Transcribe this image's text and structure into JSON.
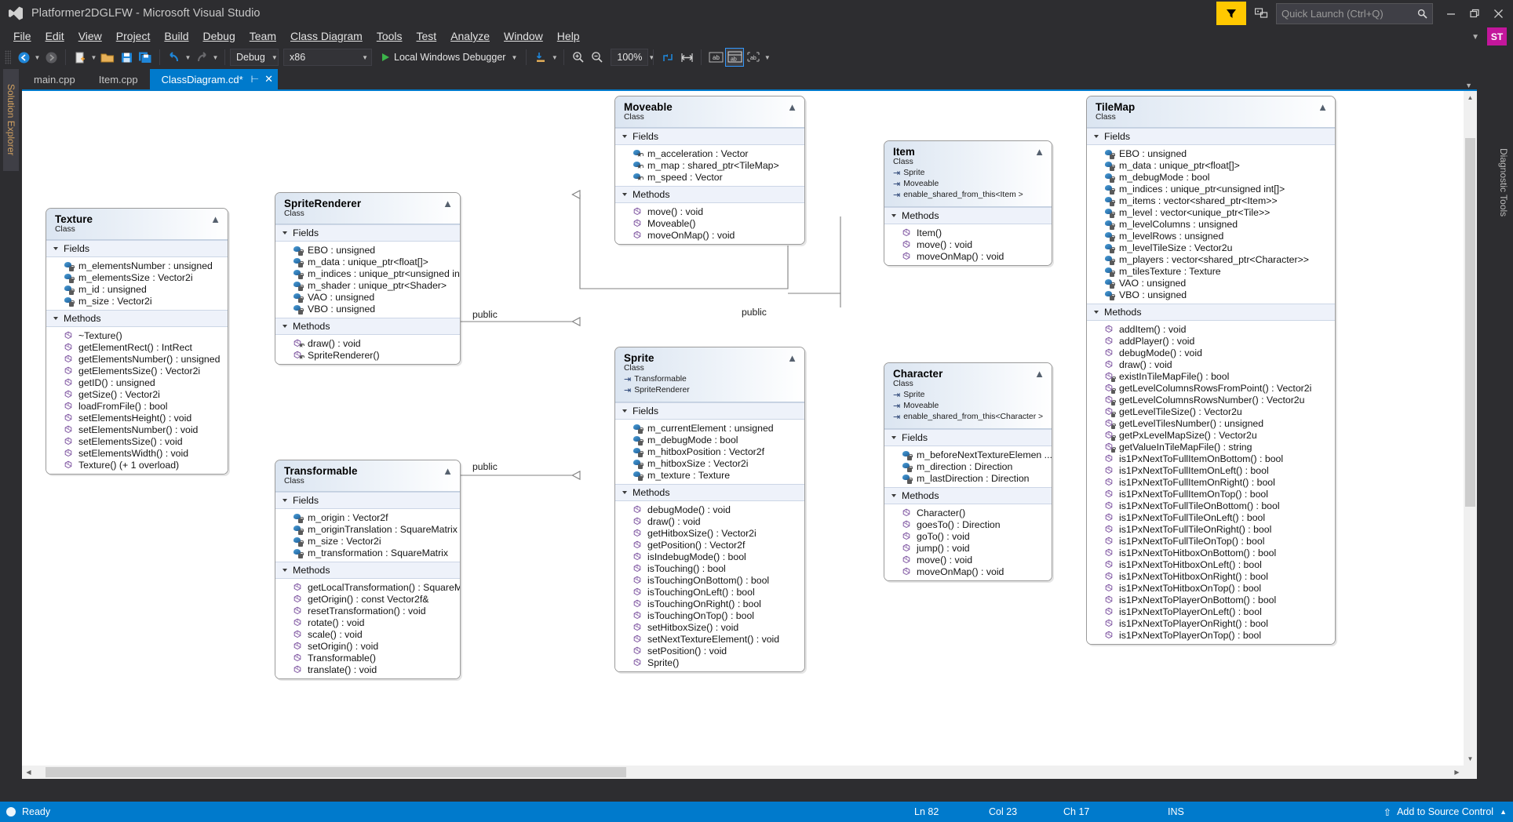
{
  "window": {
    "title": "Platformer2DGLFW - Microsoft Visual Studio",
    "logo_icon": "visual-studio-logo",
    "minimize_icon": "minimize-icon",
    "restore_icon": "restore-icon",
    "close_icon": "close-icon"
  },
  "quick_launch": {
    "placeholder": "Quick Launch (Ctrl+Q)",
    "value": "",
    "search_icon": "magnifier-icon"
  },
  "account": {
    "initials": "ST",
    "color": "#c3169c"
  },
  "feedback_icon": "send-feedback-icon",
  "notify_flag_icon": "notification-flag-icon",
  "menu": [
    {
      "label": "File"
    },
    {
      "label": "Edit"
    },
    {
      "label": "View"
    },
    {
      "label": "Project"
    },
    {
      "label": "Build"
    },
    {
      "label": "Debug"
    },
    {
      "label": "Team"
    },
    {
      "label": "Class Diagram"
    },
    {
      "label": "Tools"
    },
    {
      "label": "Test"
    },
    {
      "label": "Analyze"
    },
    {
      "label": "Window"
    },
    {
      "label": "Help"
    }
  ],
  "toolbar": {
    "nav_back_icon": "navigate-back-icon",
    "nav_forward_icon": "navigate-forward-icon",
    "new_item_icon": "new-item-icon",
    "open_file_icon": "open-file-icon",
    "save_icon": "save-icon",
    "save_all_icon": "save-all-icon",
    "undo_icon": "undo-icon",
    "redo_icon": "redo-icon",
    "config": "Debug",
    "platform": "x86",
    "start_label": "Local Windows Debugger",
    "start_icon": "play-icon",
    "step_icon": "step-into-icon",
    "zoom_in_icon": "zoom-in-icon",
    "zoom_out_icon": "zoom-out-icon",
    "zoom_value": "100%",
    "layout_icon": "auto-layout-icon",
    "fit_icon": "fit-width-icon",
    "member_format_full_icon": "display-full-signature-icon",
    "member_format_name_icon": "display-name-icon",
    "member_format_none_icon": "display-name-and-type-icon"
  },
  "tabs": [
    {
      "label": "main.cpp",
      "active": false
    },
    {
      "label": "Item.cpp",
      "active": false
    },
    {
      "label": "ClassDiagram.cd*",
      "active": true,
      "pin_icon": "pin-icon",
      "close_icon": "close-icon"
    }
  ],
  "left_rail": {
    "label": "Solution Explorer"
  },
  "right_rail": {
    "label": "Diagnostic Tools"
  },
  "canvas": {
    "section_fields": "Fields",
    "section_methods": "Methods",
    "kind_label": "Class",
    "collapse_icon": "collapse-chevron-icon",
    "connector_label": "public"
  },
  "classes": [
    {
      "id": "texture",
      "name": "Texture",
      "kind": "Class",
      "bases": [],
      "fields": [
        {
          "name": "m_elementsNumber : unsigned",
          "access": "private"
        },
        {
          "name": "m_elementsSize : Vector2i",
          "access": "private"
        },
        {
          "name": "m_id : unsigned",
          "access": "private"
        },
        {
          "name": "m_size : Vector2i",
          "access": "private"
        }
      ],
      "methods": [
        {
          "name": "~Texture()",
          "access": "public"
        },
        {
          "name": "getElementRect() : IntRect",
          "access": "public"
        },
        {
          "name": "getElementsNumber() : unsigned",
          "access": "public"
        },
        {
          "name": "getElementsSize() : Vector2i",
          "access": "public"
        },
        {
          "name": "getID() : unsigned",
          "access": "public"
        },
        {
          "name": "getSize() : Vector2i",
          "access": "public"
        },
        {
          "name": "loadFromFile() : bool",
          "access": "public"
        },
        {
          "name": "setElementsHeight() : void",
          "access": "public"
        },
        {
          "name": "setElementsNumber() : void",
          "access": "public"
        },
        {
          "name": "setElementsSize() : void",
          "access": "public"
        },
        {
          "name": "setElementsWidth() : void",
          "access": "public"
        },
        {
          "name": "Texture() (+ 1 overload)",
          "access": "public"
        }
      ]
    },
    {
      "id": "spriterenderer",
      "name": "SpriteRenderer",
      "kind": "Class",
      "bases": [],
      "fields": [
        {
          "name": "EBO : unsigned",
          "access": "private"
        },
        {
          "name": "m_data : unique_ptr<float[]>",
          "access": "private"
        },
        {
          "name": "m_indices : unique_ptr<unsigned int[]>",
          "access": "private"
        },
        {
          "name": "m_shader : unique_ptr<Shader>",
          "access": "private"
        },
        {
          "name": "VAO : unsigned",
          "access": "private"
        },
        {
          "name": "VBO : unsigned",
          "access": "private"
        }
      ],
      "methods": [
        {
          "name": "draw() : void",
          "access": "protected"
        },
        {
          "name": "SpriteRenderer()",
          "access": "protected"
        }
      ]
    },
    {
      "id": "transformable",
      "name": "Transformable",
      "kind": "Class",
      "bases": [],
      "fields": [
        {
          "name": "m_origin : Vector2f",
          "access": "private"
        },
        {
          "name": "m_originTranslation : SquareMatrix",
          "access": "private"
        },
        {
          "name": "m_size : Vector2i",
          "access": "private"
        },
        {
          "name": "m_transformation : SquareMatrix",
          "access": "private"
        }
      ],
      "methods": [
        {
          "name": "getLocalTransformation()  : SquareMat...",
          "access": "public"
        },
        {
          "name": "getOrigin() : const Vector2f&",
          "access": "public"
        },
        {
          "name": "resetTransformation() : void",
          "access": "public"
        },
        {
          "name": "rotate() : void",
          "access": "public"
        },
        {
          "name": "scale() : void",
          "access": "public"
        },
        {
          "name": "setOrigin() : void",
          "access": "public"
        },
        {
          "name": "Transformable()",
          "access": "public"
        },
        {
          "name": "translate() : void",
          "access": "public"
        }
      ]
    },
    {
      "id": "moveable",
      "name": "Moveable",
      "kind": "Class",
      "bases": [],
      "fields": [
        {
          "name": "m_acceleration : Vector",
          "access": "protected"
        },
        {
          "name": "m_map : shared_ptr<TileMap>",
          "access": "protected"
        },
        {
          "name": "m_speed : Vector",
          "access": "protected"
        }
      ],
      "methods": [
        {
          "name": "move() : void",
          "access": "public"
        },
        {
          "name": "Moveable()",
          "access": "public"
        },
        {
          "name": "moveOnMap() : void",
          "access": "public"
        }
      ]
    },
    {
      "id": "item",
      "name": "Item",
      "kind": "Class",
      "bases": [
        "Sprite",
        "Moveable",
        "enable_shared_from_this<Item >"
      ],
      "fields": [],
      "methods": [
        {
          "name": "Item()",
          "access": "public"
        },
        {
          "name": "move() : void",
          "access": "public"
        },
        {
          "name": "moveOnMap() : void",
          "access": "public"
        }
      ]
    },
    {
      "id": "sprite",
      "name": "Sprite",
      "kind": "Class",
      "bases": [
        "Transformable",
        "SpriteRenderer"
      ],
      "fields": [
        {
          "name": "m_currentElement : unsigned",
          "access": "private"
        },
        {
          "name": "m_debugMode : bool",
          "access": "private"
        },
        {
          "name": "m_hitboxPosition : Vector2f",
          "access": "private"
        },
        {
          "name": "m_hitboxSize : Vector2i",
          "access": "private"
        },
        {
          "name": "m_texture : Texture",
          "access": "private"
        }
      ],
      "methods": [
        {
          "name": "debugMode() : void",
          "access": "public"
        },
        {
          "name": "draw() : void",
          "access": "public"
        },
        {
          "name": "getHitboxSize() : Vector2i",
          "access": "public"
        },
        {
          "name": "getPosition() : Vector2f",
          "access": "public"
        },
        {
          "name": "isIndebugMode() : bool",
          "access": "public"
        },
        {
          "name": "isTouching() : bool",
          "access": "public"
        },
        {
          "name": "isTouchingOnBottom() : bool",
          "access": "public"
        },
        {
          "name": "isTouchingOnLeft() : bool",
          "access": "public"
        },
        {
          "name": "isTouchingOnRight() : bool",
          "access": "public"
        },
        {
          "name": "isTouchingOnTop() : bool",
          "access": "public"
        },
        {
          "name": "setHitboxSize() : void",
          "access": "public"
        },
        {
          "name": "setNextTextureElement() : void",
          "access": "public"
        },
        {
          "name": "setPosition() : void",
          "access": "public"
        },
        {
          "name": "Sprite()",
          "access": "public"
        }
      ]
    },
    {
      "id": "character",
      "name": "Character",
      "kind": "Class",
      "bases": [
        "Sprite",
        "Moveable",
        "enable_shared_from_this<Character >"
      ],
      "fields": [
        {
          "name": "m_beforeNextTextureElemen ...",
          "access": "private"
        },
        {
          "name": "m_direction : Direction",
          "access": "private"
        },
        {
          "name": "m_lastDirection : Direction",
          "access": "private"
        }
      ],
      "methods": [
        {
          "name": "Character()",
          "access": "public"
        },
        {
          "name": "goesTo() : Direction",
          "access": "public"
        },
        {
          "name": "goTo() : void",
          "access": "public"
        },
        {
          "name": "jump() : void",
          "access": "public"
        },
        {
          "name": "move() : void",
          "access": "public"
        },
        {
          "name": "moveOnMap() : void",
          "access": "public"
        }
      ]
    },
    {
      "id": "tilemap",
      "name": "TileMap",
      "kind": "Class",
      "bases": [],
      "fields": [
        {
          "name": "EBO : unsigned",
          "access": "private"
        },
        {
          "name": "m_data : unique_ptr<float[]>",
          "access": "private"
        },
        {
          "name": "m_debugMode : bool",
          "access": "private"
        },
        {
          "name": "m_indices : unique_ptr<unsigned int[]>",
          "access": "private"
        },
        {
          "name": "m_items : vector<shared_ptr<Item>>",
          "access": "private"
        },
        {
          "name": "m_level : vector<unique_ptr<Tile>>",
          "access": "private"
        },
        {
          "name": "m_levelColumns : unsigned",
          "access": "private"
        },
        {
          "name": "m_levelRows : unsigned",
          "access": "private"
        },
        {
          "name": "m_levelTileSize : Vector2u",
          "access": "private"
        },
        {
          "name": "m_players : vector<shared_ptr<Character>>",
          "access": "private"
        },
        {
          "name": "m_tilesTexture : Texture",
          "access": "private"
        },
        {
          "name": "VAO : unsigned",
          "access": "private"
        },
        {
          "name": "VBO : unsigned",
          "access": "private"
        }
      ],
      "methods": [
        {
          "name": "addItem() : void",
          "access": "public"
        },
        {
          "name": "addPlayer() : void",
          "access": "public"
        },
        {
          "name": "debugMode() : void",
          "access": "public"
        },
        {
          "name": "draw() : void",
          "access": "public"
        },
        {
          "name": "existInTileMapFile() : bool",
          "access": "private"
        },
        {
          "name": "getLevelColumnsRowsFromPoint() : Vector2i",
          "access": "private"
        },
        {
          "name": "getLevelColumnsRowsNumber() : Vector2u",
          "access": "private"
        },
        {
          "name": "getLevelTileSize() : Vector2u",
          "access": "private"
        },
        {
          "name": "getLevelTilesNumber() : unsigned",
          "access": "private"
        },
        {
          "name": "getPxLevelMapSize() : Vector2u",
          "access": "private"
        },
        {
          "name": "getValueInTileMapFile() : string",
          "access": "private"
        },
        {
          "name": "is1PxNextToFullItemOnBottom() : bool",
          "access": "public"
        },
        {
          "name": "is1PxNextToFullItemOnLeft() : bool",
          "access": "public"
        },
        {
          "name": "is1PxNextToFullItemOnRight() : bool",
          "access": "public"
        },
        {
          "name": "is1PxNextToFullItemOnTop() : bool",
          "access": "public"
        },
        {
          "name": "is1PxNextToFullTileOnBottom() : bool",
          "access": "public"
        },
        {
          "name": "is1PxNextToFullTileOnLeft() : bool",
          "access": "public"
        },
        {
          "name": "is1PxNextToFullTileOnRight() : bool",
          "access": "public"
        },
        {
          "name": "is1PxNextToFullTileOnTop() : bool",
          "access": "public"
        },
        {
          "name": "is1PxNextToHitboxOnBottom() : bool",
          "access": "public"
        },
        {
          "name": "is1PxNextToHitboxOnLeft() : bool",
          "access": "public"
        },
        {
          "name": "is1PxNextToHitboxOnRight() : bool",
          "access": "public"
        },
        {
          "name": "is1PxNextToHitboxOnTop() : bool",
          "access": "public"
        },
        {
          "name": "is1PxNextToPlayerOnBottom() : bool",
          "access": "public"
        },
        {
          "name": "is1PxNextToPlayerOnLeft() : bool",
          "access": "public"
        },
        {
          "name": "is1PxNextToPlayerOnRight() : bool",
          "access": "public"
        },
        {
          "name": "is1PxNextToPlayerOnTop() : bool",
          "access": "public"
        }
      ]
    }
  ],
  "connectors": [
    {
      "from": "item",
      "to": "moveable",
      "label": "public"
    },
    {
      "from": "item",
      "to": "sprite",
      "label": "public"
    },
    {
      "from": "character",
      "to": "sprite",
      "label": "public"
    },
    {
      "from": "character",
      "to": "moveable",
      "label": "public"
    },
    {
      "from": "sprite",
      "to": "spriterenderer",
      "label": "public"
    },
    {
      "from": "sprite",
      "to": "transformable",
      "label": "public"
    }
  ],
  "statusbar": {
    "state": "Ready",
    "line": "Ln 82",
    "col": "Col 23",
    "ch": "Ch 17",
    "insert_mode": "INS",
    "source_control": "Add to Source Control",
    "upload_icon": "upload-arrow-icon",
    "expand_icon": "chevron-up-icon"
  }
}
